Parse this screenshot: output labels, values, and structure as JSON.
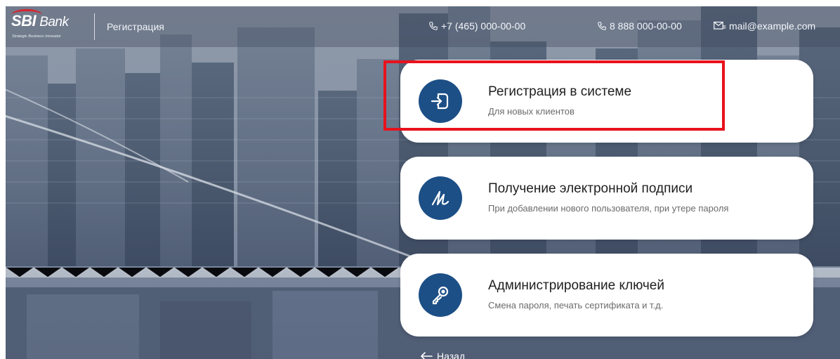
{
  "header": {
    "logo": {
      "brand": "SBI",
      "bank": "Bank",
      "tagline": "Strategic Business Innovator"
    },
    "title": "Регистрация",
    "contacts": [
      {
        "icon": "phone-icon",
        "text": "+7 (465) 000-00-00"
      },
      {
        "icon": "phone-icon",
        "text": "8 888 000-00-00"
      },
      {
        "icon": "mail-icon",
        "text": "mail@example.com"
      }
    ]
  },
  "cards": [
    {
      "icon": "sign-in-icon",
      "title": "Регистрация в системе",
      "subtitle": "Для новых клиентов",
      "highlighted": true
    },
    {
      "icon": "signature-icon",
      "title": "Получение электронной подписи",
      "subtitle": "При добавлении нового пользователя, при утере пароля",
      "highlighted": false
    },
    {
      "icon": "key-icon",
      "title": "Администрирование ключей",
      "subtitle": "Смена пароля, печать сертификата и т.д.",
      "highlighted": false
    }
  ],
  "back_link": {
    "icon": "arrow-left-icon",
    "label": "Назад"
  },
  "colors": {
    "accent": "#1c4f86",
    "highlight": "#e8121d",
    "brand_red": "#d9232d",
    "card_bg": "#ffffff"
  }
}
